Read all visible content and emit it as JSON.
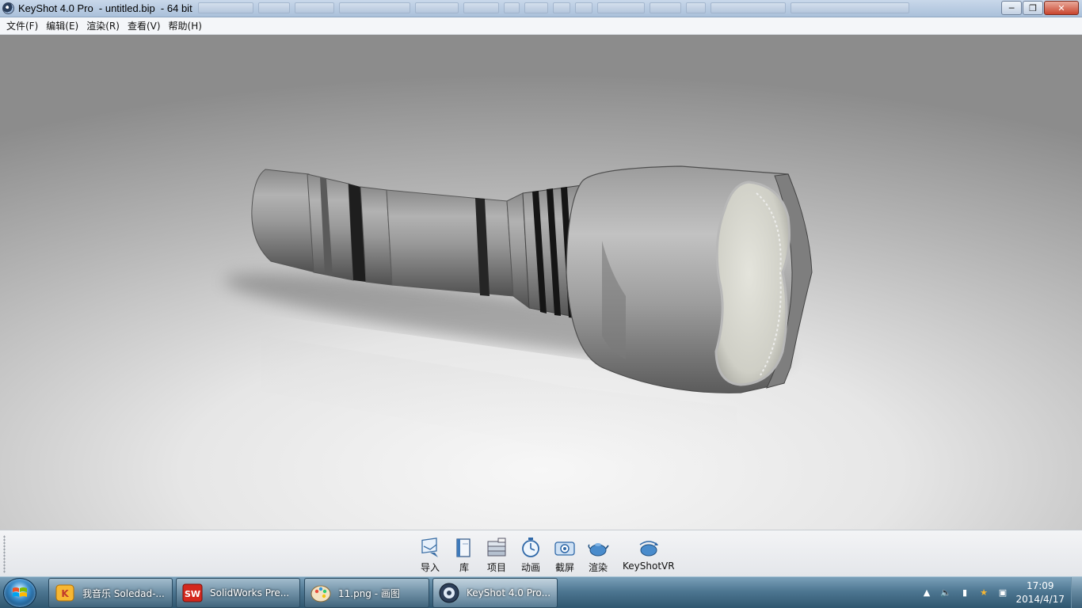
{
  "window": {
    "title": "KeyShot 4.0 Pro  - untitled.bip  - 64 bit",
    "icon": "keyshot-app-icon",
    "controls": [
      "minimize-icon",
      "restore-icon",
      "close-icon"
    ]
  },
  "menu": {
    "items": [
      "文件(F)",
      "编辑(E)",
      "渲染(R)",
      "查看(V)",
      "帮助(H)"
    ]
  },
  "viewport": {
    "content": "flashlight-model-render"
  },
  "toolbar": {
    "buttons": [
      {
        "label": "导入",
        "icon": "import-icon"
      },
      {
        "label": "库",
        "icon": "library-icon"
      },
      {
        "label": "项目",
        "icon": "project-icon"
      },
      {
        "label": "动画",
        "icon": "animation-icon"
      },
      {
        "label": "截屏",
        "icon": "screenshot-icon"
      },
      {
        "label": "渲染",
        "icon": "render-icon"
      },
      {
        "label": "KeyShotVR",
        "icon": "keyshotvr-icon"
      }
    ]
  },
  "taskbar": {
    "start_icon": "windows-start-icon",
    "tasks": [
      {
        "label": "我音乐 Soledad-...",
        "icon": "music-player-icon",
        "active": false
      },
      {
        "label": "SolidWorks Pre...",
        "icon": "solidworks-icon",
        "active": false
      },
      {
        "label": "11.png - 画图",
        "icon": "paint-icon",
        "active": false
      },
      {
        "label": "KeyShot 4.0 Pro...",
        "icon": "keyshot-icon",
        "active": true
      }
    ],
    "tray_icons": [
      "show-hidden-icons-arrow",
      "volume-icon",
      "device-icon",
      "app-tray-icon",
      "network-icon"
    ],
    "clock": {
      "time": "17:09",
      "date": "2014/4/17"
    }
  }
}
